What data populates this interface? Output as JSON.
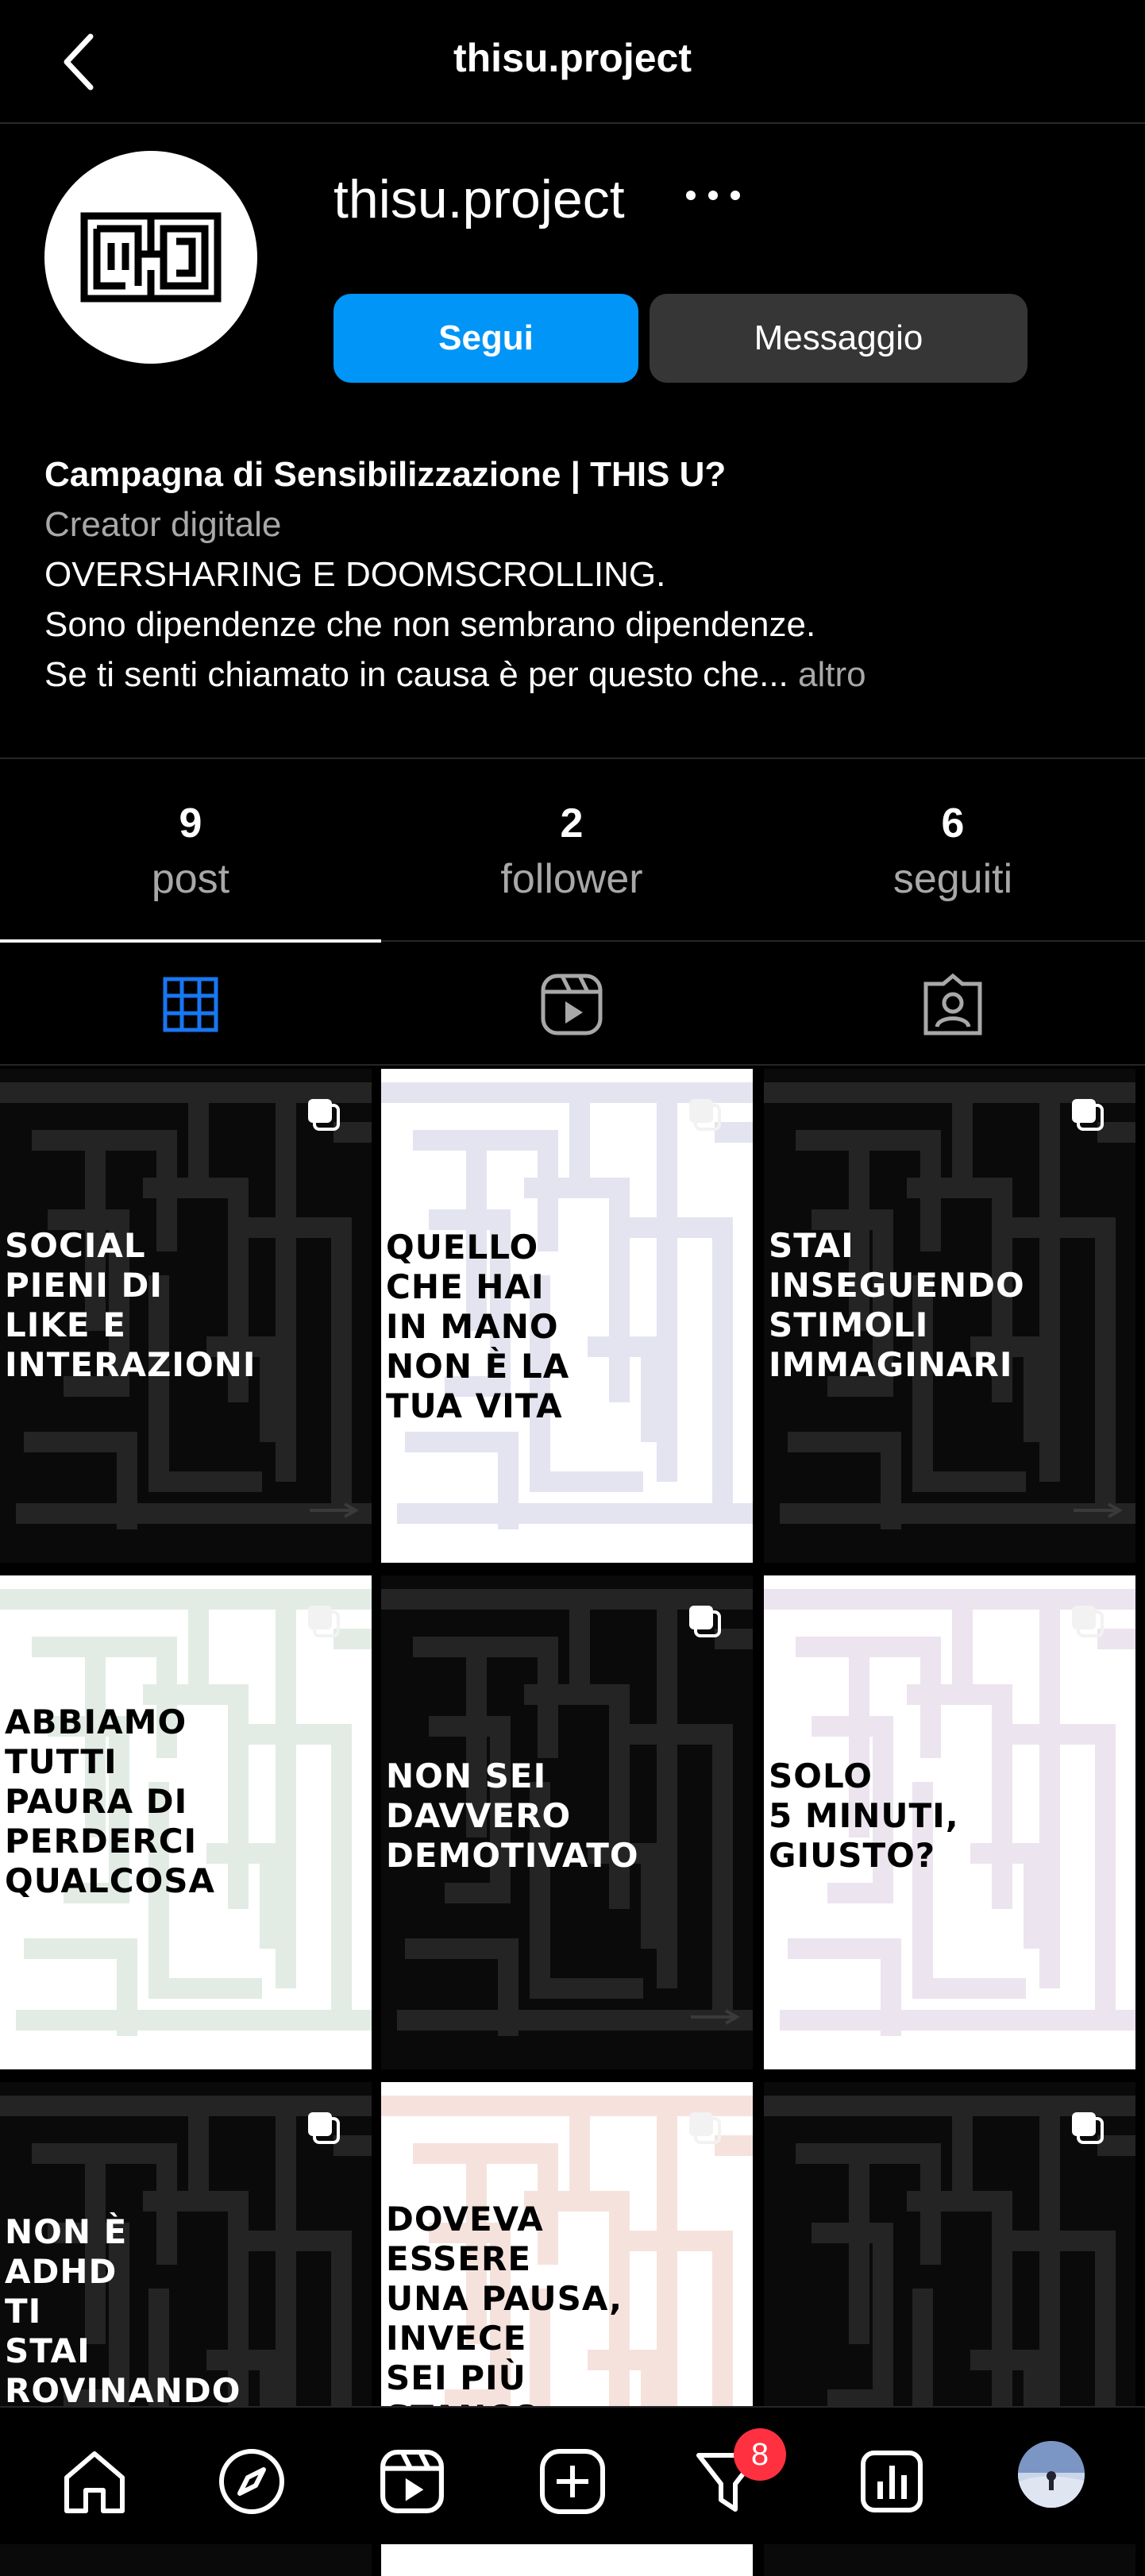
{
  "header": {
    "title": "thisu.project",
    "back_icon": "chevron-left-icon"
  },
  "profile": {
    "username": "thisu.project",
    "follow_label": "Segui",
    "message_label": "Messaggio",
    "bio": {
      "name": "Campagna di Sensibilizzazione | THIS U?",
      "category": "Creator digitale",
      "line1": "OVERSHARING E DOOMSCROLLING.",
      "line2": "Sono dipendenze che non sembrano dipendenze.",
      "line3": "Se ti senti chiamato in causa è per questo che...",
      "more_label": "altro"
    },
    "stats": [
      {
        "value": "9",
        "label": "post"
      },
      {
        "value": "2",
        "label": "follower"
      },
      {
        "value": "6",
        "label": "seguiti"
      }
    ]
  },
  "tabs": [
    {
      "name": "grid",
      "icon": "grid-icon",
      "active": true
    },
    {
      "name": "reels",
      "icon": "reels-icon",
      "active": false
    },
    {
      "name": "tagged",
      "icon": "tagged-icon",
      "active": false
    }
  ],
  "posts": [
    {
      "text": "SOCIAL\nPIENI DI\nLIKE E\nINTERAZIONI",
      "theme": "dark",
      "multi": true
    },
    {
      "text": "QUELLO\nCHE HAI\nIN MANO\nNON È LA\nTUA VITA",
      "theme": "light",
      "tint": "#e4e4f0",
      "multi": true
    },
    {
      "text": "STAI\nINSEGUENDO\nSTIMOLI\nIMMAGINARI",
      "theme": "dark",
      "multi": true
    },
    {
      "text": "ABBIAMO\nTUTTI\nPAURA DI\nPERDERCI\nQUALCOSA",
      "theme": "light",
      "tint": "#e2ece4",
      "multi": true
    },
    {
      "text": "NON SEI\nDAVVERO\nDEMOTIVATO",
      "theme": "dark",
      "multi": true
    },
    {
      "text": "SOLO\n5 MINUTI,\nGIUSTO?",
      "theme": "light",
      "tint": "#ece4ee",
      "multi": true
    },
    {
      "text": "NON È\nADHD\nTI\nSTAI\nROVINANDO",
      "theme": "dark",
      "multi": true
    },
    {
      "text": "DOVEVA\nESSERE\nUNA PAUSA,\nINVECE\nSEI PIÙ\nSTANCO",
      "theme": "light",
      "tint": "#f6e2dc",
      "multi": true
    },
    {
      "text": "",
      "theme": "dark",
      "multi": true
    }
  ],
  "bottom_nav": [
    {
      "icon": "home-icon"
    },
    {
      "icon": "explore-icon"
    },
    {
      "icon": "reels-icon"
    },
    {
      "icon": "create-icon"
    },
    {
      "icon": "activity-icon",
      "badge": "8"
    },
    {
      "icon": "insights-icon"
    },
    {
      "icon": "profile-avatar"
    }
  ],
  "colors": {
    "accent": "#0095f6",
    "badge": "#ff3040",
    "secondary_text": "#a8a8a8"
  }
}
